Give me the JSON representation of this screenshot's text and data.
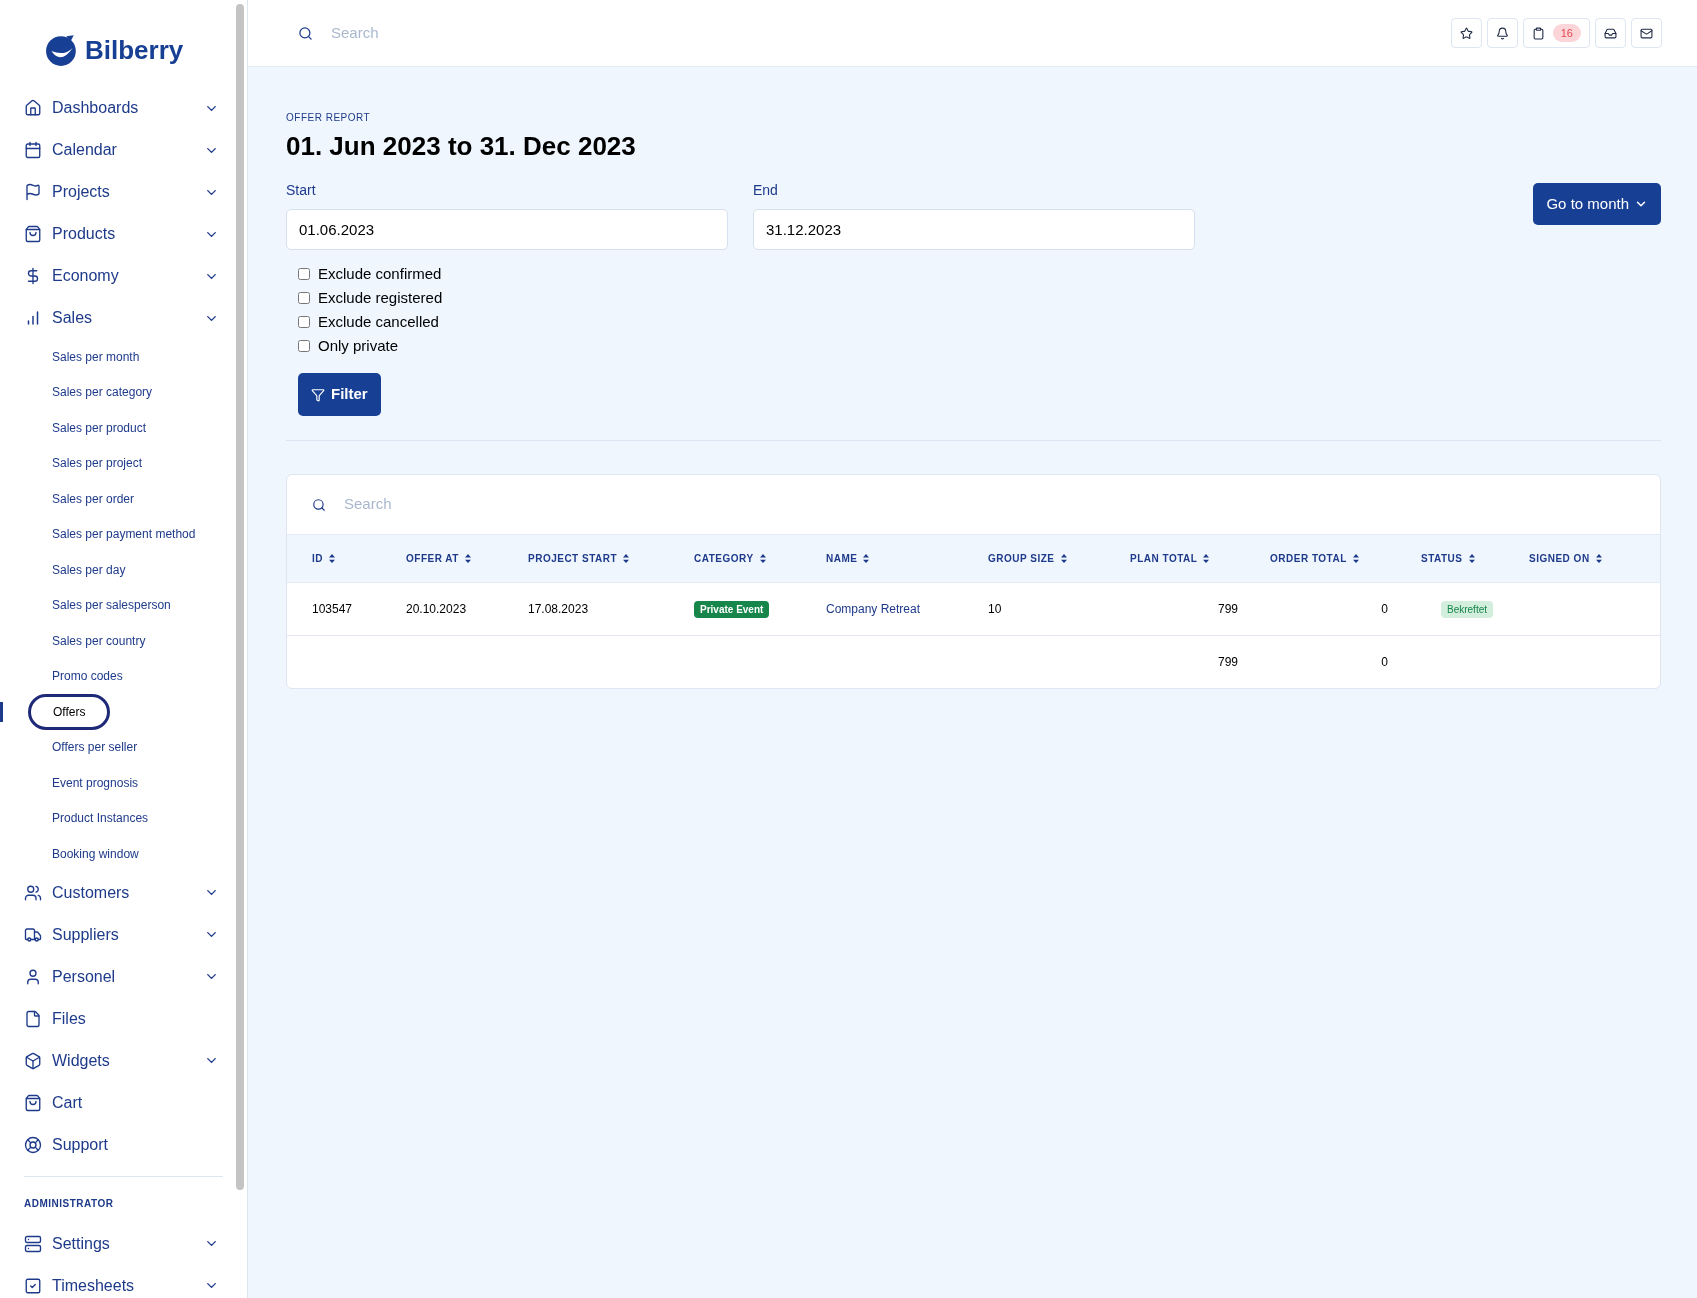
{
  "brand": {
    "name": "Bilberry"
  },
  "sidebar": {
    "items": [
      {
        "label": "Dashboards",
        "kind": "menu"
      },
      {
        "label": "Calendar",
        "kind": "menu"
      },
      {
        "label": "Projects",
        "kind": "menu"
      },
      {
        "label": "Products",
        "kind": "menu"
      },
      {
        "label": "Economy",
        "kind": "menu"
      },
      {
        "label": "Sales",
        "kind": "menu",
        "children": [
          {
            "label": "Sales per month",
            "selected": false
          },
          {
            "label": "Sales per category",
            "selected": false
          },
          {
            "label": "Sales per product",
            "selected": false
          },
          {
            "label": "Sales per project",
            "selected": false
          },
          {
            "label": "Sales per order",
            "selected": false
          },
          {
            "label": "Sales per payment method",
            "selected": false
          },
          {
            "label": "Sales per day",
            "selected": false
          },
          {
            "label": "Sales per salesperson",
            "selected": false
          },
          {
            "label": "Sales per country",
            "selected": false
          },
          {
            "label": "Promo codes",
            "selected": false
          },
          {
            "label": "Offers",
            "selected": true
          },
          {
            "label": "Offers per seller",
            "selected": false
          },
          {
            "label": "Event prognosis",
            "selected": false
          },
          {
            "label": "Product Instances",
            "selected": false
          },
          {
            "label": "Booking window",
            "selected": false
          }
        ]
      },
      {
        "label": "Customers",
        "kind": "menu"
      },
      {
        "label": "Suppliers",
        "kind": "menu"
      },
      {
        "label": "Personel",
        "kind": "menu"
      },
      {
        "label": "Files",
        "kind": "link"
      },
      {
        "label": "Widgets",
        "kind": "menu"
      },
      {
        "label": "Cart",
        "kind": "link"
      },
      {
        "label": "Support",
        "kind": "link"
      }
    ],
    "admin_heading": "ADMINISTRATOR",
    "admin_items": [
      {
        "label": "Settings",
        "kind": "menu"
      },
      {
        "label": "Timesheets",
        "kind": "menu"
      }
    ]
  },
  "topbar": {
    "search": {
      "placeholder": "Search"
    },
    "tasks_badge": "16"
  },
  "report": {
    "eyebrow": "OFFER REPORT",
    "title": "01. Jun 2023 to 31. Dec 2023",
    "start": {
      "label": "Start",
      "value": "01.06.2023"
    },
    "end": {
      "label": "End",
      "value": "31.12.2023"
    },
    "go_to_month": "Go to month",
    "checkboxes": [
      {
        "label": "Exclude confirmed",
        "checked": false
      },
      {
        "label": "Exclude registered",
        "checked": false
      },
      {
        "label": "Exclude cancelled",
        "checked": false
      },
      {
        "label": "Only private",
        "checked": false
      }
    ],
    "filter_button": "Filter"
  },
  "table": {
    "search": {
      "placeholder": "Search"
    },
    "columns": [
      "ID",
      "OFFER AT",
      "PROJECT START",
      "CATEGORY",
      "NAME",
      "GROUP SIZE",
      "PLAN TOTAL",
      "ORDER TOTAL",
      "STATUS",
      "SIGNED ON"
    ],
    "rows": [
      {
        "id": "103547",
        "offer_at": "20.10.2023",
        "project_start": "17.08.2023",
        "category": "Private Event",
        "name": "Company Retreat",
        "group_size": "10",
        "plan_total": "799",
        "order_total": "0",
        "status": "Bekreftet"
      }
    ],
    "totals": {
      "plan_total": "799",
      "order_total": "0"
    }
  }
}
